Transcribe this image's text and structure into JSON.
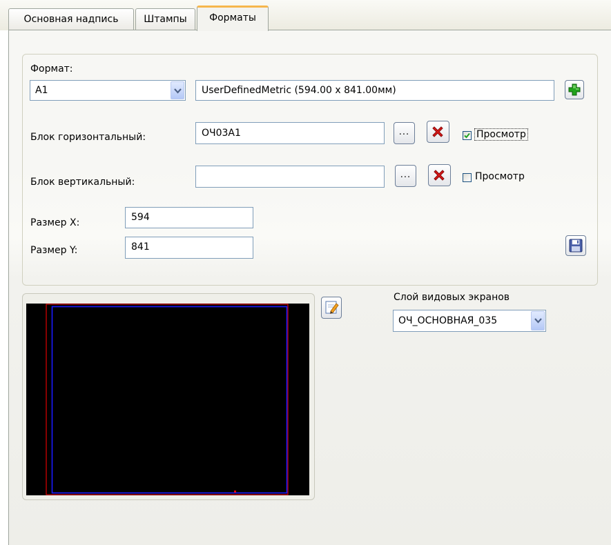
{
  "tabs": [
    {
      "label": "Основная надпись",
      "active": false
    },
    {
      "label": "Штампы",
      "active": false
    },
    {
      "label": "Форматы",
      "active": true
    }
  ],
  "format": {
    "label": "Формат:",
    "selected": "A1",
    "description": "UserDefinedMetric (594.00 x 841.00мм)"
  },
  "block_horizontal": {
    "label": "Блок горизонтальный:",
    "value": "ОЧ03А1",
    "browse_label": "...",
    "preview_label": "Просмотр",
    "preview_checked": true
  },
  "block_vertical": {
    "label": "Блок вертикальный:",
    "value": "",
    "browse_label": "...",
    "preview_label": "Просмотр",
    "preview_checked": false
  },
  "size_x": {
    "label": "Размер X:",
    "value": "594"
  },
  "size_y": {
    "label": "Размер Y:",
    "value": "841"
  },
  "viewport_layer": {
    "label": "Слой видовых экранов",
    "selected": "ОЧ_ОСНОВНАЯ_035"
  },
  "colors": {
    "tab_highlight": "#f6b64c",
    "preview_background": "#000000",
    "preview_red_border": "#e00000",
    "preview_blue_border": "#1a1aff",
    "add_icon": "#22a31c",
    "delete_icon": "#d81818"
  },
  "icons": {
    "add": "plus-icon",
    "delete": "delete-x-icon",
    "save": "floppy-disk-icon",
    "edit": "edit-pencil-icon",
    "dropdown": "chevron-down-icon"
  }
}
